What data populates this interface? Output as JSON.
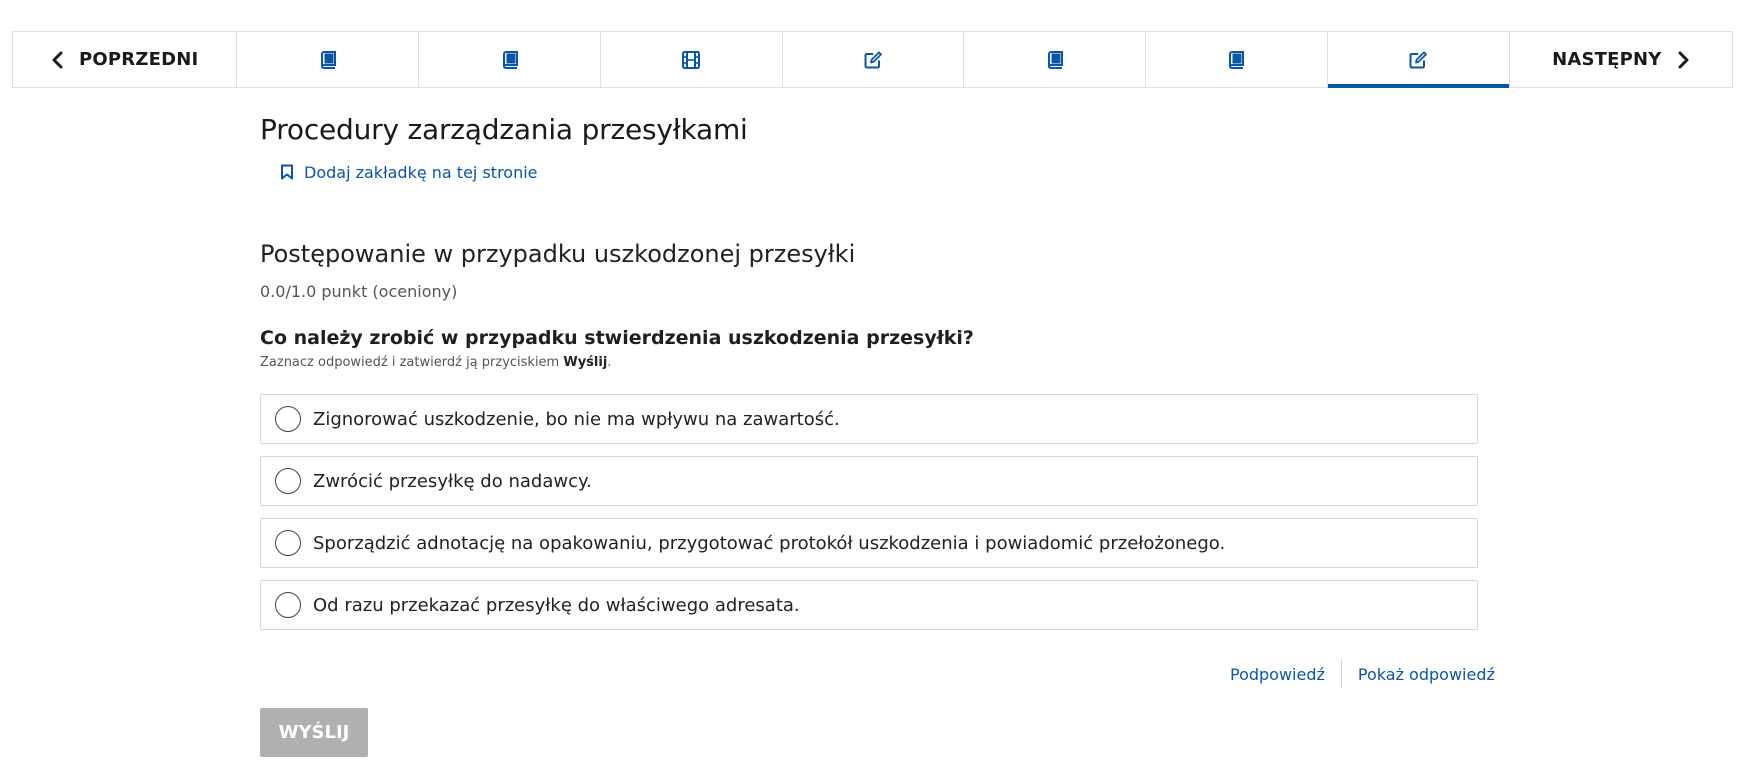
{
  "nav": {
    "prev_label": "POPRZEDNI",
    "next_label": "NASTĘPNY",
    "tabs": [
      {
        "icon": "book-icon"
      },
      {
        "icon": "book-icon"
      },
      {
        "icon": "video-icon"
      },
      {
        "icon": "edit-icon"
      },
      {
        "icon": "book-icon"
      },
      {
        "icon": "book-icon"
      },
      {
        "icon": "edit-icon",
        "active": true
      }
    ]
  },
  "unit": {
    "title": "Procedury zarządzania przesyłkami",
    "bookmark_label": "Dodaj zakładkę na tej stronie"
  },
  "problem": {
    "title": "Postępowanie w przypadku uszkodzonej przesyłki",
    "score": "0.0/1.0 punkt (oceniony)",
    "question": "Co należy zrobić w przypadku stwierdzenia uszkodzenia przesyłki?",
    "instruction_prefix": "Zaznacz odpowiedź i zatwierdź ją przyciskiem ",
    "instruction_bold": "Wyślij",
    "instruction_suffix": ".",
    "choices": [
      "Zignorować uszkodzenie, bo nie ma wpływu na zawartość.",
      "Zwrócić przesyłkę do nadawcy.",
      "Sporządzić adnotację na opakowaniu, przygotować protokół uszkodzenia i powiadomić przełożonego.",
      "Od razu przekazać przesyłkę do właściwego adresata."
    ]
  },
  "actions": {
    "hint_label": "Podpowiedź",
    "show_answer_label": "Pokaż odpowiedź",
    "submit_label": "WYŚLIJ"
  },
  "colors": {
    "accent": "#0a56a6",
    "submit_disabled": "#b0b0b0"
  }
}
